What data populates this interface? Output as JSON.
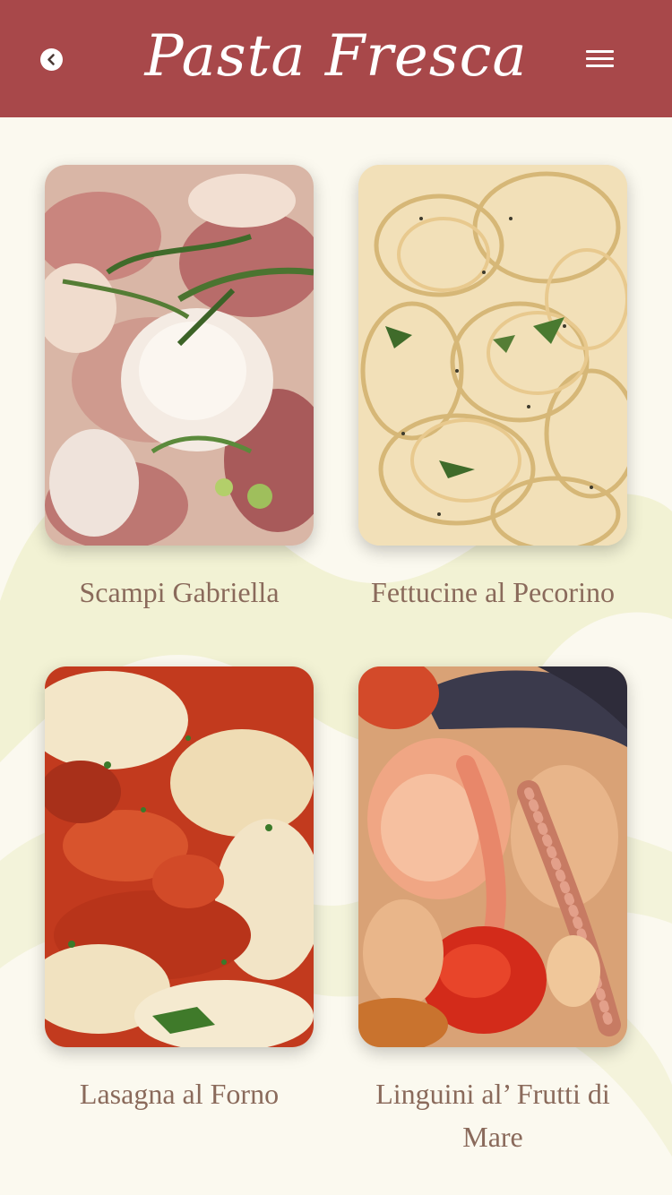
{
  "header": {
    "brand_title": "Pasta Fresca",
    "background_color": "#a8484a",
    "back_icon": "chevron-left-circle-icon",
    "menu_icon": "hamburger-menu-icon"
  },
  "dishes": [
    {
      "name": "Scampi Gabriella",
      "photo": "shrimp-pasta-photo"
    },
    {
      "name": "Fettucine al Pecorino",
      "photo": "fettuccine-cheese-photo"
    },
    {
      "name": "Lasagna al Forno",
      "photo": "baked-lasagna-photo"
    },
    {
      "name": "Linguini al’ Frutti di Mare",
      "photo": "seafood-pasta-photo"
    }
  ],
  "theme": {
    "page_background": "#fbf9ef",
    "swash_color": "#eeeec8",
    "dish_label_color": "#8a6a5b"
  }
}
